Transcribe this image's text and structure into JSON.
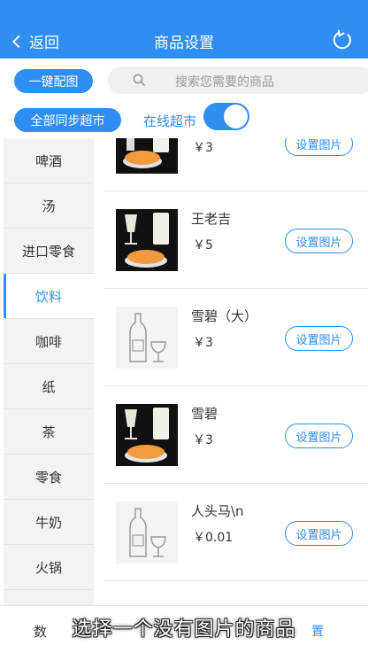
{
  "header": {
    "back_label": "返回",
    "title": "商品设置",
    "refresh_icon": "refresh-icon"
  },
  "toolbar": {
    "one_key_label": "一键配图",
    "search_placeholder": "搜索您需要的商品",
    "sync_all_label": "全部同步超市",
    "online_label": "在线超市",
    "online_toggle_on": true
  },
  "categories": [
    "啤酒",
    "汤",
    "进口零食",
    "饮料",
    "咖啡",
    "纸",
    "茶",
    "零食",
    "牛奶",
    "火锅"
  ],
  "active_category": "饮料",
  "products": [
    {
      "name": "",
      "price": "￥3",
      "image": "photo",
      "button": "设置图片"
    },
    {
      "name": "王老吉",
      "price": "￥5",
      "image": "photo",
      "button": "设置图片"
    },
    {
      "name": "雪碧（大）",
      "price": "￥3",
      "image": "placeholder",
      "button": "设置图片"
    },
    {
      "name": "雪碧",
      "price": "￥3",
      "image": "photo",
      "button": "设置图片"
    },
    {
      "name": "人头马\\n",
      "price": "￥0.01",
      "image": "placeholder",
      "button": "设置图片"
    }
  ],
  "bottom": {
    "left_text": "数",
    "right_text": "置",
    "caption": "选择一个没有图片的商品"
  },
  "colors": {
    "accent": "#2f8ef1",
    "sidebar_bg": "#f3f3f3"
  }
}
